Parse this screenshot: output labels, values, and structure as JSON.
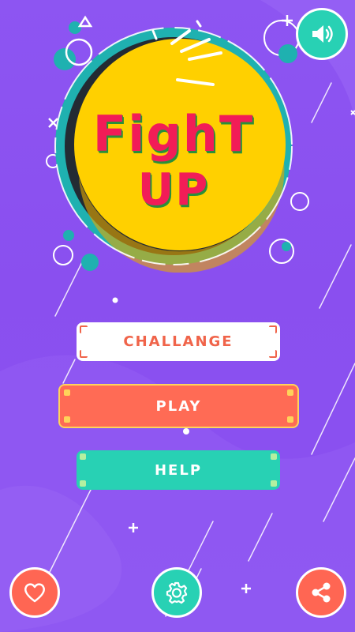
{
  "logo": {
    "line1": "FighT",
    "line2": "UP"
  },
  "menu": {
    "challenge_label": "CHALLANGE",
    "play_label": "PLAY",
    "help_label": "HELP"
  },
  "icons": {
    "sound": "speaker-icon",
    "like": "heart-icon",
    "settings": "gear-icon",
    "share": "share-icon"
  },
  "colors": {
    "background": "#8a4ff0",
    "logo_circle": "#ffd000",
    "logo_text": "#f21c57",
    "teal": "#28d1b4",
    "coral": "#ff6653",
    "challenge_text": "#f0644a"
  }
}
